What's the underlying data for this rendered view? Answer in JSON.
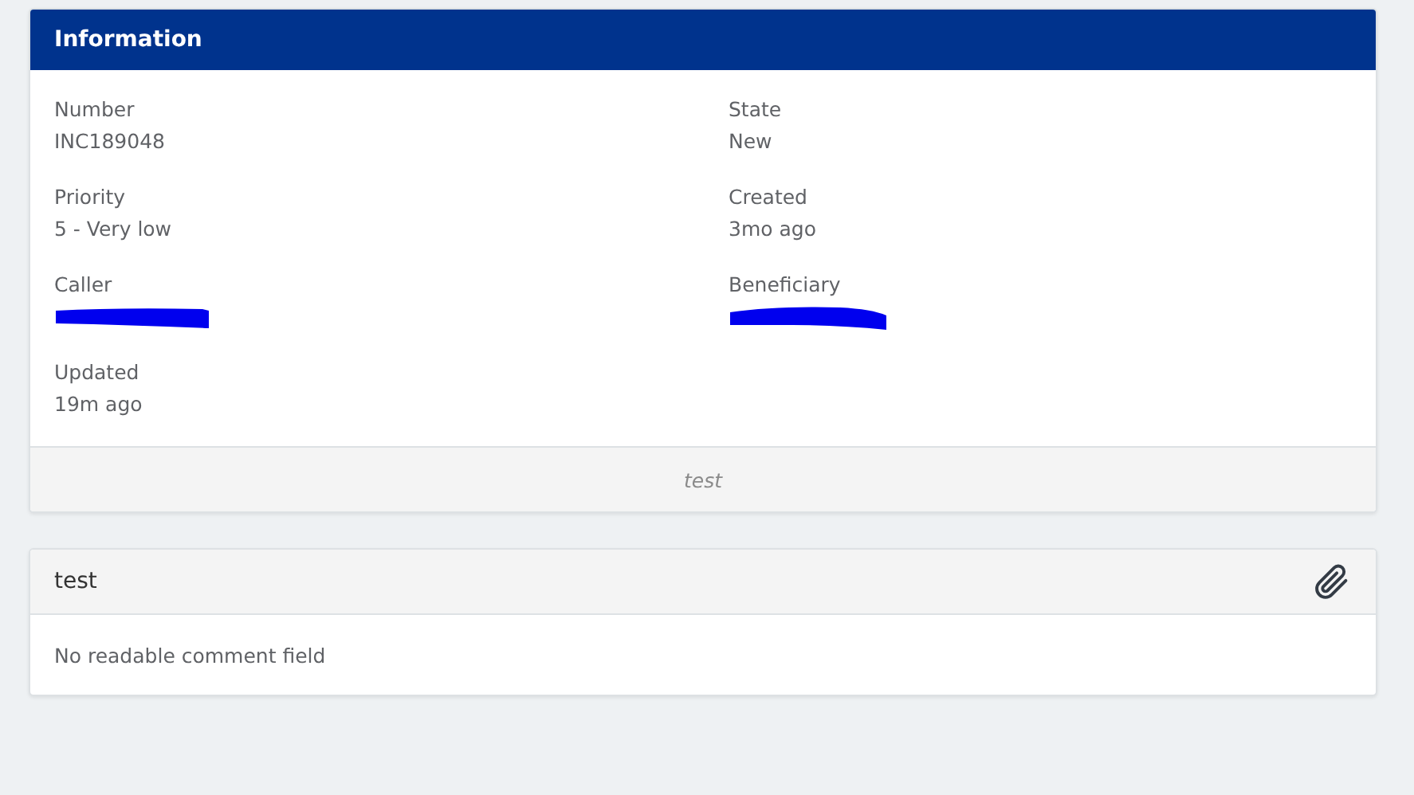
{
  "info_card": {
    "title": "Information",
    "fields": [
      {
        "label": "Number",
        "kind": "text",
        "value": "INC189048"
      },
      {
        "label": "State",
        "kind": "text",
        "value": "New"
      },
      {
        "label": "Priority",
        "kind": "text",
        "value": "5 - Very low"
      },
      {
        "label": "Created",
        "kind": "text",
        "value": "3mo ago"
      },
      {
        "label": "Caller",
        "kind": "redacted"
      },
      {
        "label": "Beneficiary",
        "kind": "redacted"
      },
      {
        "label": "Updated",
        "kind": "text",
        "value": "19m ago"
      }
    ],
    "footer": "test"
  },
  "comment_card": {
    "title": "test",
    "body": "No readable comment field"
  }
}
